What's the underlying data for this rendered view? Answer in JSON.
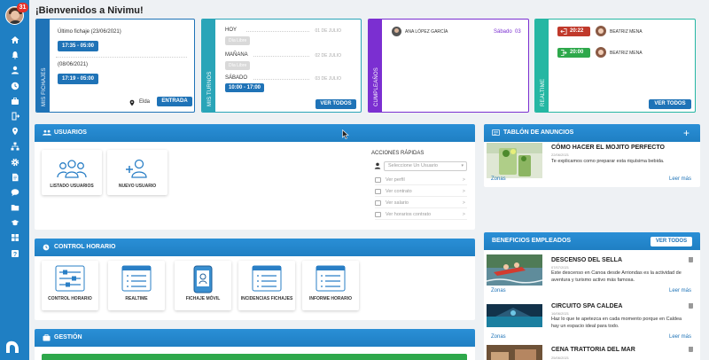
{
  "sidebar": {
    "notifications": "31",
    "icons": [
      "home-icon",
      "bell-icon",
      "user-icon",
      "clock-icon",
      "briefcase-icon",
      "door-icon",
      "pin-icon",
      "hierarchy-icon",
      "gear-icon",
      "document-icon",
      "chat-icon",
      "folder-icon",
      "graduation-icon",
      "grid-icon",
      "help-icon"
    ]
  },
  "header": {
    "title": "¡Bienvenidos a Nivimu!"
  },
  "fichajes": {
    "label": "MIS FICHAJES",
    "last_label": "Último fichaje (23/06/2021)",
    "last_range": "17:35 - 05:00",
    "prev_label": "(08/06/2021)",
    "prev_range": "17:19 - 05:00",
    "location": "Elda",
    "button": "ENTRADA"
  },
  "turnos": {
    "label": "MIS TURNOS",
    "rows": [
      {
        "day": "HOY",
        "date": "01 DE JULIO",
        "badge": "Día Libre"
      },
      {
        "day": "MAÑANA",
        "date": "02 DE JULIO",
        "badge": "Día Libre"
      },
      {
        "day": "SÁBADO",
        "date": "03 DE JULIO",
        "badge": "10:00 - 17:00"
      }
    ],
    "button": "VER TODOS"
  },
  "cumples": {
    "label": "CUMPLEAÑOS",
    "name": "ANA LÓPEZ GARCÍA",
    "day": "Sábado",
    "num": "03"
  },
  "realtime": {
    "label": "REALTIME",
    "rows": [
      {
        "time": "20:22",
        "name": "BEATRIZ MENA",
        "color": "#c0392b"
      },
      {
        "time": "20:00",
        "name": "BEATRIZ MENA",
        "color": "#2ea84b"
      }
    ],
    "button": "VER TODOS"
  },
  "usuarios": {
    "title": "USUARIOS",
    "tiles": [
      "LISTADO USUARIOS",
      "NUEVO USUARIO"
    ],
    "quick_title": "ACCIONES RÁPIDAS",
    "select_placeholder": "Seleccione Un Usuario",
    "actions": [
      "Ver perfil",
      "Ver contrato",
      "Ver salario",
      "Ver horarios contrato"
    ]
  },
  "control": {
    "title": "CONTROL HORARIO",
    "tiles": [
      "CONTROL HORARIO",
      "REALTIME",
      "FICHAJE MÓVIL",
      "INCIDENCIAS FICHAJES",
      "INFORME HORARIO"
    ]
  },
  "gestion": {
    "title": "GESTIÓN"
  },
  "anuncios": {
    "title": "TABLÓN DE ANUNCIOS",
    "item_title": "CÓMO HACER EL MOJITO PERFECTO",
    "item_date": "22/06/2021",
    "item_text": "Te explicamos como preparar esta riquísima bebida.",
    "zonas": "Zonas",
    "leer": "Leer más"
  },
  "beneficios": {
    "title": "BENEFICIOS EMPLEADOS",
    "button": "VER TODOS",
    "items": [
      {
        "title": "DESCENSO DEL SELLA",
        "date": "07/07/2021",
        "text": "Este descenso en Canoa desde Arriondas es la actividad de aventura y turismo activo más famosa.",
        "zonas": "Zonas",
        "leer": "Leer más"
      },
      {
        "title": "CIRCUITO SPA CALDEA",
        "date": "16/06/2021",
        "text": "Haz lo que te apetezca en cada momento porque en Caldea hay un espacio ideal para todo.",
        "zonas": "Zonas",
        "leer": "Leer más"
      },
      {
        "title": "CENA TRATTORIA DEL MAR",
        "date": "25/06/2021"
      }
    ]
  }
}
